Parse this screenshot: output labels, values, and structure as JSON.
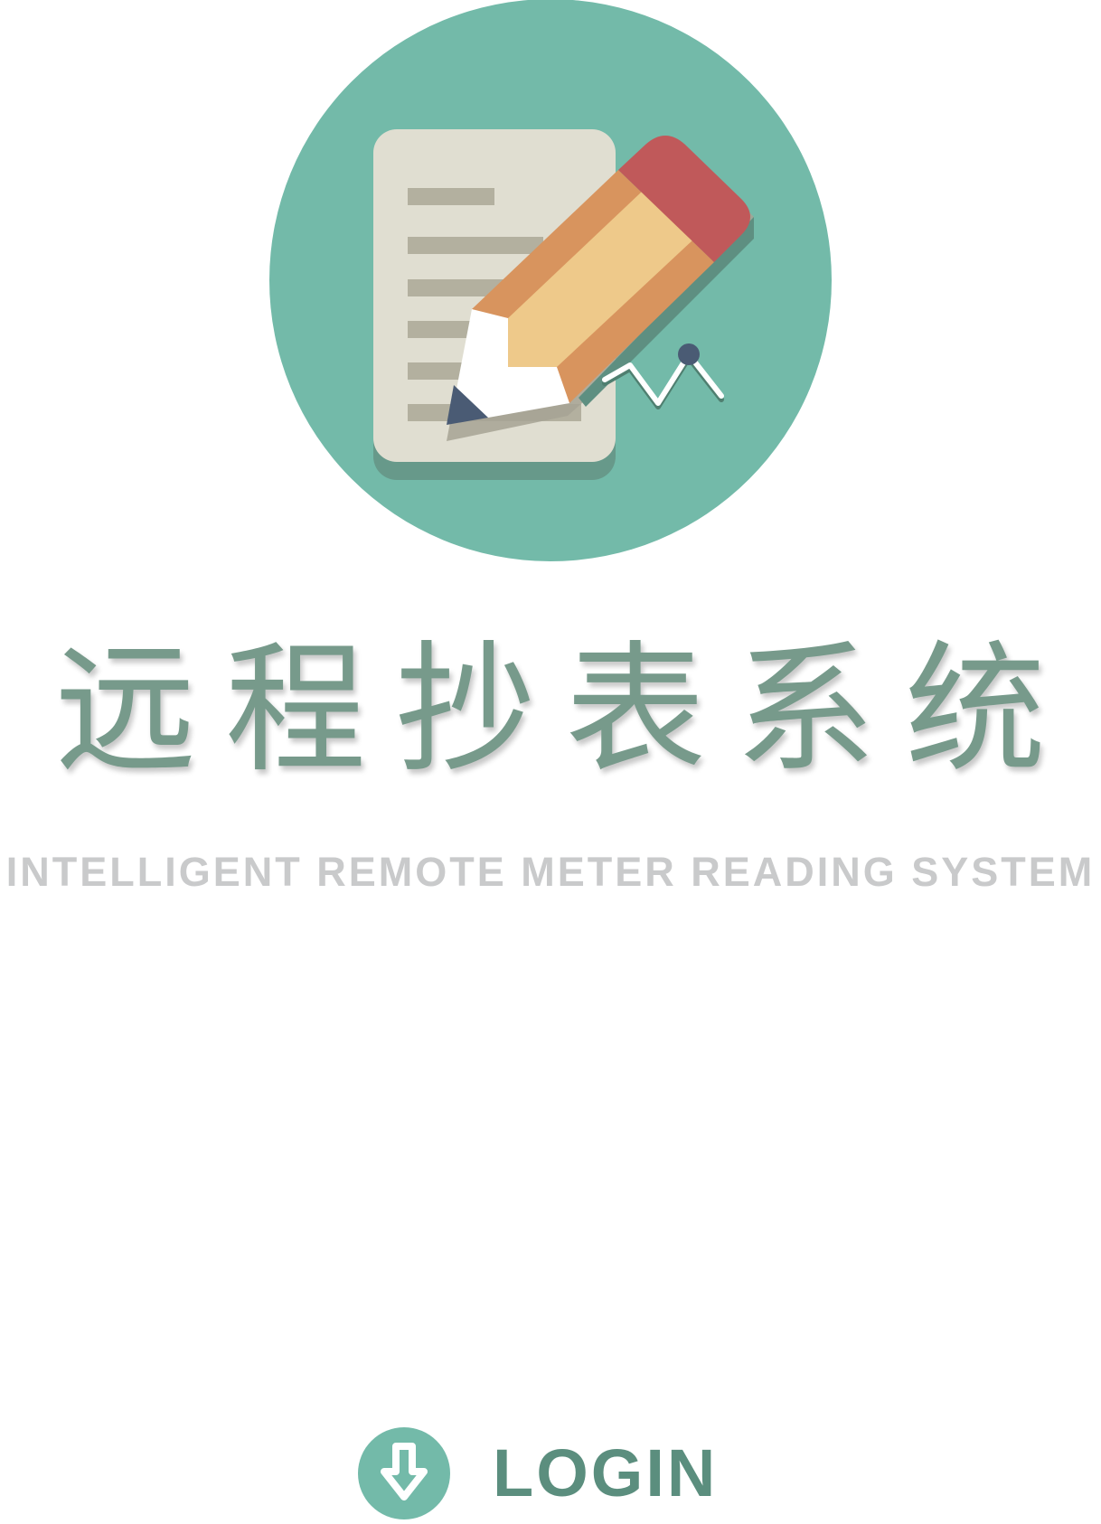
{
  "app": {
    "title_cn": "远程抄表系统",
    "subtitle_en": "INTELLIGENT REMOTE METER READING SYSTEM"
  },
  "logo": {
    "icon": "document-pencil-icon",
    "colors": {
      "circle": "#73baa9",
      "paper": "#e0ded1",
      "paper_lines": "#b3b09f",
      "pencil_body": "#eec98a",
      "pencil_edge": "#d8945e",
      "eraser": "#c0595a",
      "graphite": "#4a5b74"
    }
  },
  "login": {
    "label": "LOGIN",
    "icon": "arrow-down-circle-icon"
  },
  "colors": {
    "title": "#779a8b",
    "subtitle": "#c9cacb",
    "accent": "#73baa9",
    "login_text": "#5b8e7e"
  }
}
